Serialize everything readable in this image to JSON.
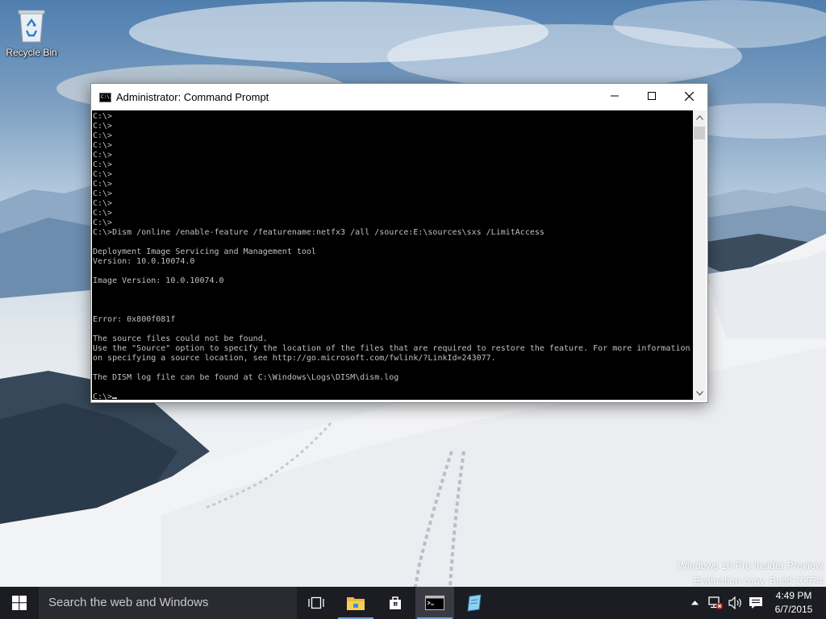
{
  "desktop": {
    "recycle_bin_label": "Recycle Bin"
  },
  "window": {
    "title": "Administrator: Command Prompt",
    "app_icon_text": "C:\\.",
    "console_lines": [
      "C:\\>",
      "C:\\>",
      "C:\\>",
      "C:\\>",
      "C:\\>",
      "C:\\>",
      "C:\\>",
      "C:\\>",
      "C:\\>",
      "C:\\>",
      "C:\\>",
      "C:\\>",
      "C:\\>Dism /online /enable-feature /featurename:netfx3 /all /source:E:\\sources\\sxs /LimitAccess",
      "",
      "Deployment Image Servicing and Management tool",
      "Version: 10.0.10074.0",
      "",
      "Image Version: 10.0.10074.0",
      "",
      "",
      "",
      "Error: 0x800f081f",
      "",
      "The source files could not be found.",
      "Use the \"Source\" option to specify the location of the files that are required to restore the feature. For more information",
      "on specifying a source location, see http://go.microsoft.com/fwlink/?LinkId=243077.",
      "",
      "The DISM log file can be found at C:\\Windows\\Logs\\DISM\\dism.log",
      "",
      "C:\\>"
    ],
    "text_color": "#c0c0c0",
    "background_color": "#000000"
  },
  "watermark": {
    "line1": "Windows 10 Pro Insider Preview",
    "line2": "Evaluation copy. Build 10074"
  },
  "taskbar": {
    "search_placeholder": "Search the web and Windows",
    "accent_color": "#76a2d6",
    "time": "4:49 PM",
    "date": "6/7/2015"
  }
}
